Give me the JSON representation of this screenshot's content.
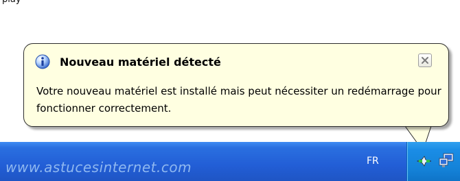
{
  "page": {
    "top_text": "play"
  },
  "balloon": {
    "title": "Nouveau matériel détecté",
    "body": "Votre nouveau matériel est installé mais peut nécessiter un redémarrage pour fonctionner correctement.",
    "icon": "info-icon",
    "close_icon": "close-icon",
    "background_color": "#ffffe1"
  },
  "taskbar": {
    "watermark": "www.astucesinternet.com",
    "language": "FR",
    "tray_icons": [
      "new-hardware-icon",
      "network-computer-icon"
    ],
    "color": "#225ed6",
    "tray_color": "#1482d8"
  }
}
